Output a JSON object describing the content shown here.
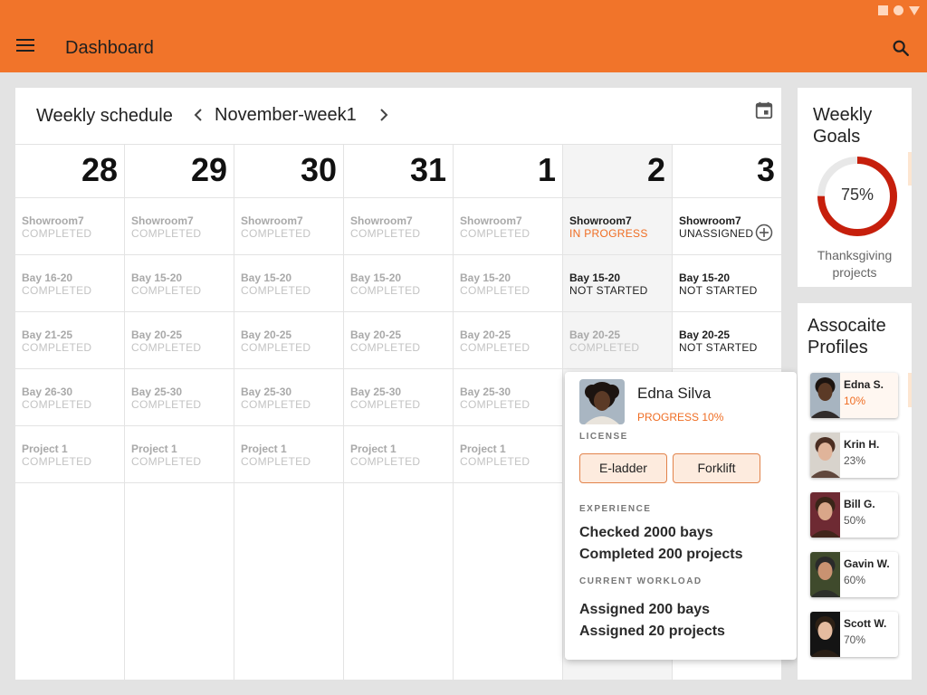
{
  "appbar": {
    "title": "Dashboard"
  },
  "schedule": {
    "title": "Weekly schedule",
    "week": "November-week1",
    "days": [
      {
        "num": "28",
        "today": false,
        "slots": [
          {
            "loc": "Showroom7",
            "status": "COMPLETED",
            "state": "done"
          },
          {
            "loc": "Bay 16-20",
            "status": "COMPLETED",
            "state": "done"
          },
          {
            "loc": "Bay 21-25",
            "status": "COMPLETED",
            "state": "done"
          },
          {
            "loc": "Bay 26-30",
            "status": "COMPLETED",
            "state": "done"
          },
          {
            "loc": "Project 1",
            "status": "COMPLETED",
            "state": "done"
          }
        ]
      },
      {
        "num": "29",
        "today": false,
        "slots": [
          {
            "loc": "Showroom7",
            "status": "COMPLETED",
            "state": "done"
          },
          {
            "loc": "Bay 15-20",
            "status": "COMPLETED",
            "state": "done"
          },
          {
            "loc": "Bay 20-25",
            "status": "COMPLETED",
            "state": "done"
          },
          {
            "loc": "Bay 25-30",
            "status": "COMPLETED",
            "state": "done"
          },
          {
            "loc": "Project 1",
            "status": "COMPLETED",
            "state": "done"
          }
        ]
      },
      {
        "num": "30",
        "today": false,
        "slots": [
          {
            "loc": "Showroom7",
            "status": "COMPLETED",
            "state": "done"
          },
          {
            "loc": "Bay 15-20",
            "status": "COMPLETED",
            "state": "done"
          },
          {
            "loc": "Bay 20-25",
            "status": "COMPLETED",
            "state": "done"
          },
          {
            "loc": "Bay 25-30",
            "status": "COMPLETED",
            "state": "done"
          },
          {
            "loc": "Project 1",
            "status": "COMPLETED",
            "state": "done"
          }
        ]
      },
      {
        "num": "31",
        "today": false,
        "slots": [
          {
            "loc": "Showroom7",
            "status": "COMPLETED",
            "state": "done"
          },
          {
            "loc": "Bay 15-20",
            "status": "COMPLETED",
            "state": "done"
          },
          {
            "loc": "Bay 20-25",
            "status": "COMPLETED",
            "state": "done"
          },
          {
            "loc": "Bay 25-30",
            "status": "COMPLETED",
            "state": "done"
          },
          {
            "loc": "Project 1",
            "status": "COMPLETED",
            "state": "done"
          }
        ]
      },
      {
        "num": "1",
        "today": false,
        "slots": [
          {
            "loc": "Showroom7",
            "status": "COMPLETED",
            "state": "done"
          },
          {
            "loc": "Bay 15-20",
            "status": "COMPLETED",
            "state": "done"
          },
          {
            "loc": "Bay 20-25",
            "status": "COMPLETED",
            "state": "done"
          },
          {
            "loc": "Bay 25-30",
            "status": "COMPLETED",
            "state": "done"
          },
          {
            "loc": "Project 1",
            "status": "COMPLETED",
            "state": "done"
          }
        ]
      },
      {
        "num": "2",
        "today": true,
        "slots": [
          {
            "loc": "Showroom7",
            "status": "IN PROGRESS",
            "state": "progress"
          },
          {
            "loc": "Bay 15-20",
            "status": "NOT STARTED",
            "state": "active"
          },
          {
            "loc": "Bay 20-25",
            "status": "COMPLETED",
            "state": "done"
          }
        ]
      },
      {
        "num": "3",
        "today": false,
        "slots": [
          {
            "loc": "Showroom7",
            "status": "UNASSIGNED",
            "state": "active",
            "add": true
          },
          {
            "loc": "Bay 15-20",
            "status": "NOT STARTED",
            "state": "active"
          },
          {
            "loc": "Bay 20-25",
            "status": "NOT STARTED",
            "state": "active"
          }
        ]
      }
    ]
  },
  "popup": {
    "name": "Edna Silva",
    "progress": "PROGRESS 10%",
    "license_label": "LICENSE",
    "licenses": [
      "E-ladder",
      "Forklift"
    ],
    "experience_label": "EXPERIENCE",
    "experience": [
      "Checked 2000 bays",
      "Completed 200 projects"
    ],
    "workload_label": "CURRENT WORKLOAD",
    "workload": [
      "Assigned 200 bays",
      "Assigned 20 projects"
    ]
  },
  "goals": {
    "title_line1": "Weekly",
    "title_line2": "Goals",
    "percent": 75,
    "percent_label": "75%",
    "caption_line1": "Thanksgiving",
    "caption_line2": "projects",
    "ring_color": "#c61f0c",
    "track_color": "#e8e8e8"
  },
  "profiles": {
    "title_line1": "Assocaite",
    "title_line2": "Profiles",
    "items": [
      {
        "name": "Edna S.",
        "pct": "10%",
        "selected": true,
        "skin": "#5b3a26",
        "hair": "#1c1410",
        "bg": "#a7b4c0"
      },
      {
        "name": "Krin H.",
        "pct": "23%",
        "selected": false,
        "skin": "#e0b49a",
        "hair": "#4b2e22",
        "bg": "#d8d3cc"
      },
      {
        "name": "Bill G.",
        "pct": "50%",
        "selected": false,
        "skin": "#d9a689",
        "hair": "#3a2518",
        "bg": "#6e2a33"
      },
      {
        "name": "Gavin W.",
        "pct": "60%",
        "selected": false,
        "skin": "#c99271",
        "hair": "#2a2a2a",
        "bg": "#3f4a2c"
      },
      {
        "name": "Scott W.",
        "pct": "70%",
        "selected": false,
        "skin": "#e5bca0",
        "hair": "#2d2015",
        "bg": "#141414"
      }
    ]
  }
}
